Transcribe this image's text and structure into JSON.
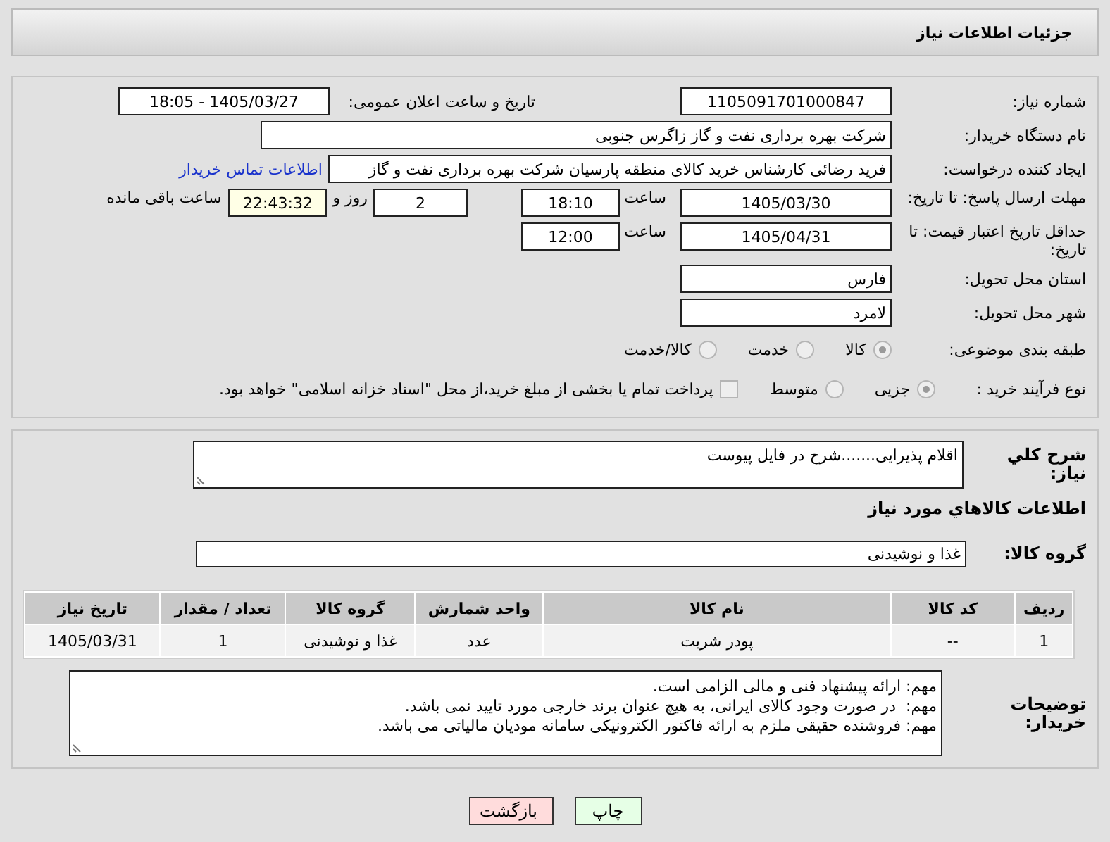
{
  "header": {
    "title": "جزئیات اطلاعات نیاز"
  },
  "need_number": {
    "label": "شماره نیاز:",
    "value": "1105091701000847"
  },
  "announce": {
    "label": "تاریخ و ساعت اعلان عمومی:",
    "value": "1405/03/27 - 18:05"
  },
  "buyer": {
    "label": "نام دستگاه خریدار:",
    "value": "شرکت بهره برداری نفت و گاز زاگرس جنوبی"
  },
  "creator": {
    "label": "ایجاد کننده درخواست:",
    "value": "فرید رضائی کارشناس خرید کالای منطقه پارسیان شرکت بهره برداری نفت و گاز",
    "link": "اطلاعات تماس خریدار"
  },
  "deadline": {
    "label": "مهلت ارسال پاسخ: تا تاریخ:",
    "date": "1405/03/30",
    "time_label": "ساعت",
    "time": "18:10",
    "days": "2",
    "days_label": "روز و",
    "remaining": "22:43:32",
    "remaining_label": "ساعت باقی مانده"
  },
  "validity": {
    "label": "حداقل تاریخ اعتبار قیمت: تا تاریخ:",
    "date": "1405/04/31",
    "time_label": "ساعت",
    "time": "12:00"
  },
  "province": {
    "label": "استان محل تحویل:",
    "value": "فارس"
  },
  "city": {
    "label": "شهر محل تحویل:",
    "value": "لامرد"
  },
  "category": {
    "label": "طبقه بندی موضوعی:",
    "options": [
      {
        "label": "کالا",
        "selected": true
      },
      {
        "label": "خدمت",
        "selected": false
      },
      {
        "label": "کالا/خدمت",
        "selected": false
      }
    ]
  },
  "process": {
    "label": "نوع فرآیند خرید :",
    "options": [
      {
        "label": "جزیی",
        "selected": true
      },
      {
        "label": "متوسط",
        "selected": false
      }
    ],
    "payment": {
      "checked": false,
      "label": "پرداخت تمام یا بخشی از مبلغ خرید،از محل \"اسناد خزانه اسلامی\" خواهد بود."
    }
  },
  "description": {
    "label": "شرح کلي نياز:",
    "value": "اقلام پذیرایی.......شرح در فایل پیوست"
  },
  "items_title": "اطلاعات کالاهاي مورد نياز",
  "goods_group": {
    "label": "گروه کالا:",
    "value": "غذا و نوشیدنی"
  },
  "table": {
    "columns": [
      "ردیف",
      "کد کالا",
      "نام کالا",
      "واحد شمارش",
      "گروه کالا",
      "تعداد / مقدار",
      "تاریخ نیاز"
    ],
    "rows": [
      [
        "1",
        "--",
        "پودر شربت",
        "عدد",
        "غذا و نوشیدنی",
        "1",
        "1405/03/31"
      ]
    ]
  },
  "buyer_notes": {
    "label": "توضیحات خریدار:",
    "lines": [
      "مهم: ارائه پیشنهاد فنی و مالی الزامی است.",
      "مهم:  در صورت وجود کالای ایرانی، به هیچ عنوان برند خارجی مورد تایید نمی باشد.",
      "مهم: فروشنده حقیقی ملزم به ارائه فاکتور الکترونیکی سامانه مودیان مالیاتی می باشد."
    ]
  },
  "buttons": [
    {
      "label": "چاپ",
      "kind": "print"
    },
    {
      "label": "بازگشت",
      "kind": "back"
    }
  ]
}
